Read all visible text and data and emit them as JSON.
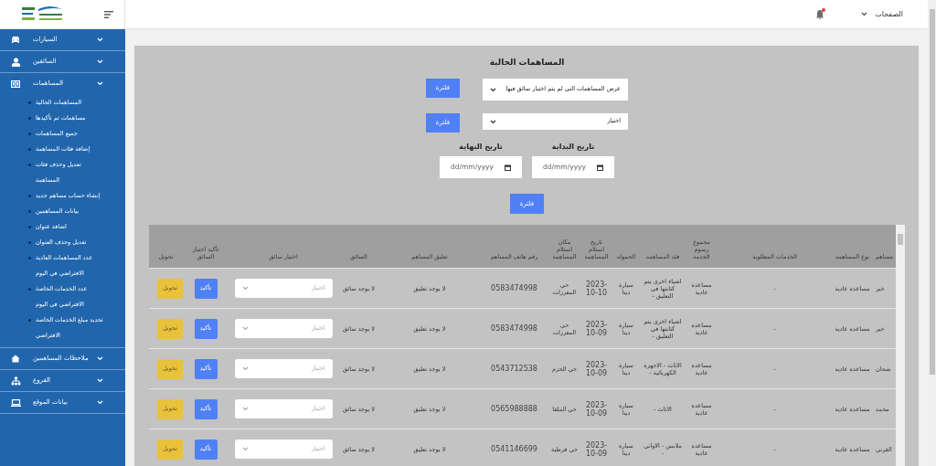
{
  "header": {
    "pages_menu": "الصفحات",
    "has_notification": true
  },
  "sidebar": {
    "items": [
      {
        "label": "السيارات"
      },
      {
        "label": "السائقين"
      },
      {
        "label": "المساهمات",
        "children": [
          {
            "label": "المساهمات الحالية"
          },
          {
            "label": "مساهمات تم تأكيدها"
          },
          {
            "label": "جميع المساهمات"
          },
          {
            "label": "إضافة فئات المساهمة"
          },
          {
            "label": "تعديل وحذف فئات المساهمة"
          },
          {
            "label": "إنشاء حساب مساهم جديد"
          },
          {
            "label": "بيانات المساهمين"
          },
          {
            "label": "اضافة عنوان"
          },
          {
            "label": "تعديل وحذف العنوان"
          },
          {
            "label": "عدد المساهمات العادية الافتراضي في اليوم"
          },
          {
            "label": "عدد الخدمات الخاصة الافتراضي في اليوم"
          },
          {
            "label": "تحديد مبلغ الخدمات الخاصة الافتراضي"
          }
        ]
      },
      {
        "label": "ملاحظات المساهمين"
      },
      {
        "label": "الفروع"
      },
      {
        "label": "بيانات الموقع"
      }
    ]
  },
  "filters": {
    "title": "المساهمات الحالية",
    "selects": [
      {
        "value": "عرض المساهمات التي لم يتم اختيار سائق فيها",
        "button": "فلترة"
      },
      {
        "value": "اختيار",
        "button": "فلترة"
      }
    ],
    "dates": [
      {
        "label": "تاريخ البداية",
        "placeholder": "dd/mm/yyyy"
      },
      {
        "label": "تاريخ النهاية",
        "placeholder": "dd/mm/yyyy"
      }
    ],
    "date_button": "فلترة"
  },
  "table": {
    "columns": [
      "مساهم",
      "نوع المساهمة",
      "الخدمات المطلوبة",
      "مجموع رسوم الخدمة",
      "فئة المساهمة",
      "الحمولة",
      "تاريخ استلام المساهمة",
      "مكان استلام المساهمة",
      "رقم هاتف المساهم",
      "تعليق المساهم",
      "السائق",
      "اختيار سائق",
      "تأكيد اختيار السائق",
      "تحويل"
    ],
    "rows": [
      {
        "name": "خير",
        "type": "مساعدة عادية",
        "services": "-",
        "fees": "مساعدة عادية",
        "category": "اشياء اخرى يتم كتابتها في التعليق -",
        "load": "سيارة دينا",
        "date": "2023-10-10",
        "place": "حي المغرزات",
        "phone": "0583474998",
        "comment": "لا يوجد تعليق",
        "driver": "لا يوجد سائق",
        "driver_select": "اختيار",
        "confirm": "تأكيد",
        "transfer": "تحويل"
      },
      {
        "name": "خير",
        "type": "مساعدة عادية",
        "services": "-",
        "fees": "مساعدة عادية",
        "category": "اشياء اخرى يتم كتابتها في التعليق -",
        "load": "سيارة دينا",
        "date": "2023-10-09",
        "place": "حي المغرزات",
        "phone": "0583474998",
        "comment": "لا يوجد تعليق",
        "driver": "لا يوجد سائق",
        "driver_select": "اختيار",
        "confirm": "تأكيد",
        "transfer": "تحويل"
      },
      {
        "name": "شحان",
        "type": "مساعدة عادية",
        "services": "-",
        "fees": "مساعدة عادية",
        "category": "الاثاث - الاجهزة الكهربائية -",
        "load": "سيارة دينا",
        "date": "2023-10-09",
        "place": "حي الحزم",
        "phone": "0543712538",
        "comment": "لا يوجد تعليق",
        "driver": "لا يوجد سائق",
        "driver_select": "اختيار",
        "confirm": "تأكيد",
        "transfer": "تحويل"
      },
      {
        "name": "محمد",
        "type": "مساعدة عادية",
        "services": "-",
        "fees": "مساعدة عادية",
        "category": "الاثاث -",
        "load": "سيارة دينا",
        "date": "2023-10-09",
        "place": "حي الملقا",
        "phone": "0565988888",
        "comment": "لا يوجد تعليق",
        "driver": "لا يوجد سائق",
        "driver_select": "اختيار",
        "confirm": "تأكيد",
        "transfer": "تحويل"
      },
      {
        "name": "القرني",
        "type": "مساعدة عادية",
        "services": "-",
        "fees": "مساعدة عادية",
        "category": "ملابس - الاواني -",
        "load": "سيارة دينا",
        "date": "2023-10-09",
        "place": "حي قرطبة",
        "phone": "0541146699",
        "comment": "لا يوجد تعليق",
        "driver": "لا يوجد سائق",
        "driver_select": "اختيار",
        "confirm": "تأكيد",
        "transfer": "تحويل"
      }
    ]
  }
}
